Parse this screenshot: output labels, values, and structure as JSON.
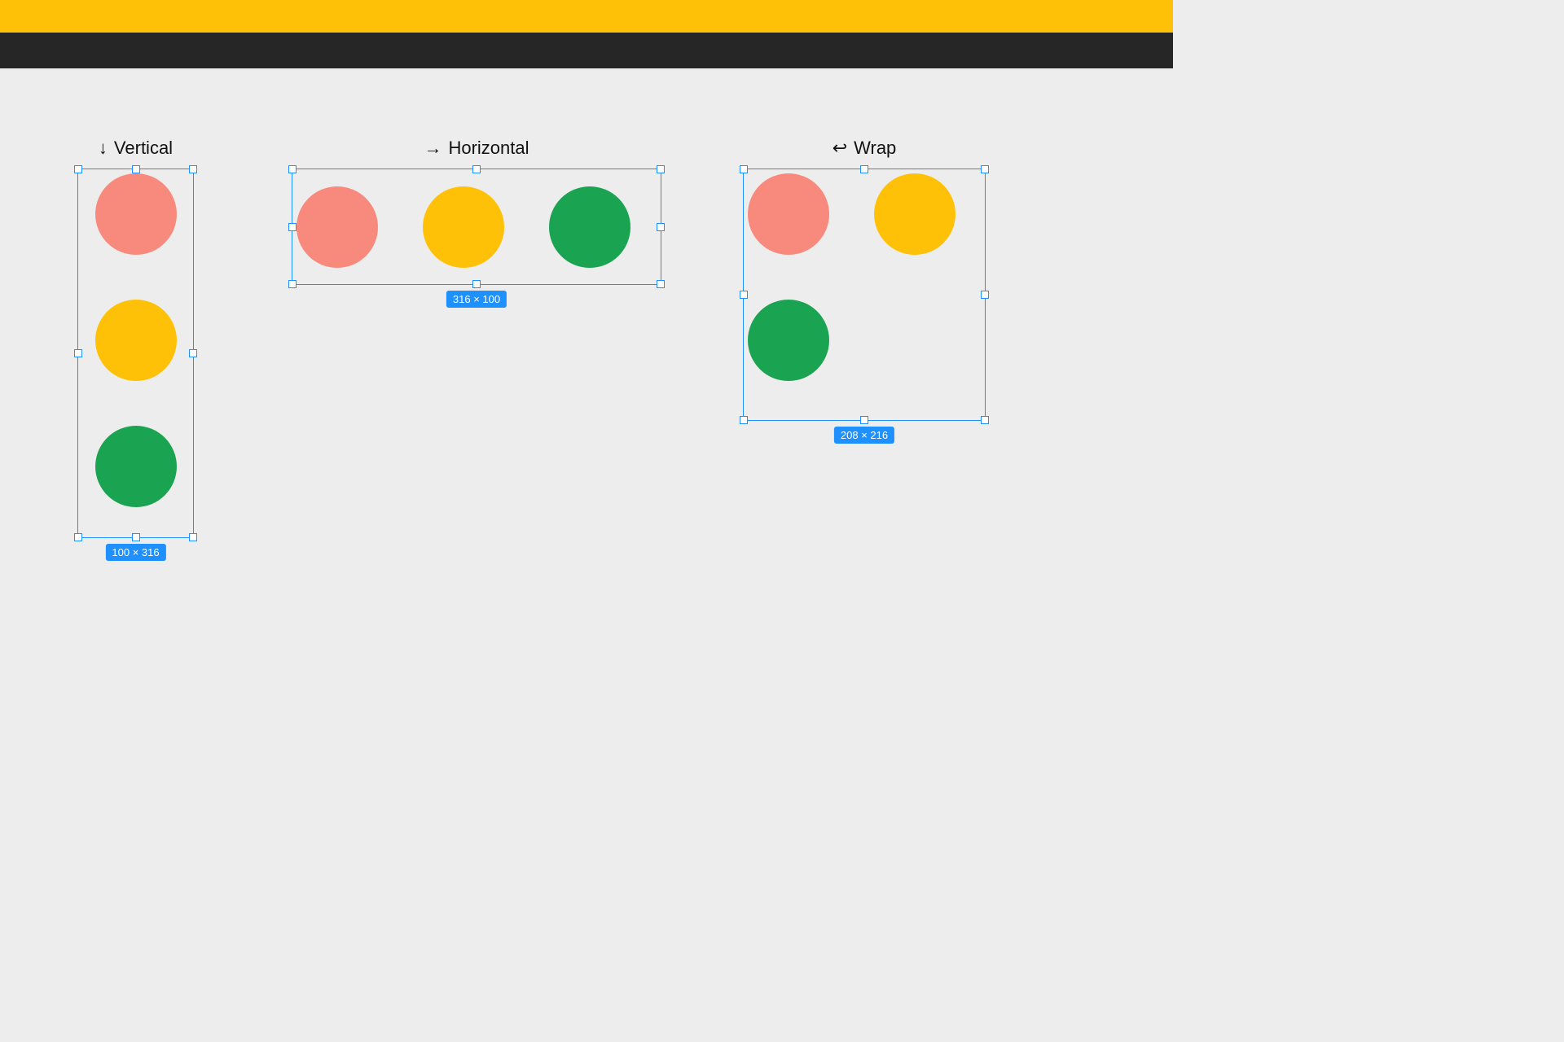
{
  "colors": {
    "accent_yellow": "#ffc107",
    "dark_bar": "#262626",
    "selection_blue": "#1e90ff",
    "circle_red": "#f8897d",
    "circle_yellow": "#ffc107",
    "circle_green": "#1aa351",
    "canvas_bg": "#ededed"
  },
  "groups": {
    "vertical": {
      "icon": "↓",
      "icon_name": "arrow-down-icon",
      "label": "Vertical",
      "dimensions": "100 × 316"
    },
    "horizontal": {
      "icon": "→",
      "icon_name": "arrow-right-icon",
      "label": "Horizontal",
      "dimensions": "316 × 100"
    },
    "wrap": {
      "icon": "↩",
      "icon_name": "wrap-arrow-icon",
      "label": "Wrap",
      "dimensions": "208 × 216"
    }
  }
}
